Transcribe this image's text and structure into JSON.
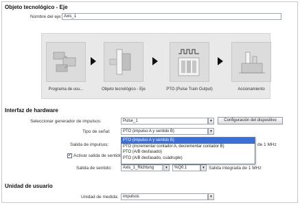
{
  "section_tech": {
    "title": "Objeto tecnológico - Eje",
    "axis_name_label": "Nombre del eje:",
    "axis_name_value": "Axis_1"
  },
  "diagram": {
    "tiles": [
      {
        "caption": "Programa de usu...",
        "icon": "program-blocks-icon"
      },
      {
        "caption": "Objeto tecnológico - Eje",
        "icon": "axis-object-icon"
      },
      {
        "caption": "PTO (Pulse Train Output)",
        "icon": "pulse-train-icon"
      },
      {
        "caption": "Accionamiento",
        "icon": "drive-icon"
      }
    ]
  },
  "section_hw": {
    "title": "Interfaz de hardware",
    "pulse_gen_label": "Seleccionar generador de impulsos:",
    "pulse_gen_value": "Pulse_1",
    "config_button": "Configuración del dispositivo",
    "signal_type_label": "Tipo de señal:",
    "signal_type_value": "PTO (impulso A y sentido B)",
    "pulse_output_label": "Salida de impulsos:",
    "pulse_output_suffix": "de 1 MHz",
    "direction_checkbox_label": "Activar salida de sentido",
    "direction_checked": true,
    "direction_output_label": "Salida de sentido:",
    "direction_output_value": "Axis_1_Richtung",
    "direction_address": "%Q0.1",
    "direction_output_suffix": "Salida integrada de 1 MHz",
    "signal_options": [
      "PTO (impulso A y sentido B)",
      "PTO (incrementar contador A, decrementar contador B)",
      "PTO (A/B desfasado)",
      "PTO (A/B desfasado, cuádruple)"
    ],
    "selected_option_index": 0
  },
  "section_user": {
    "title": "Unidad de usuario",
    "unit_label": "Unidad de medida:",
    "unit_value": "impulsos"
  }
}
